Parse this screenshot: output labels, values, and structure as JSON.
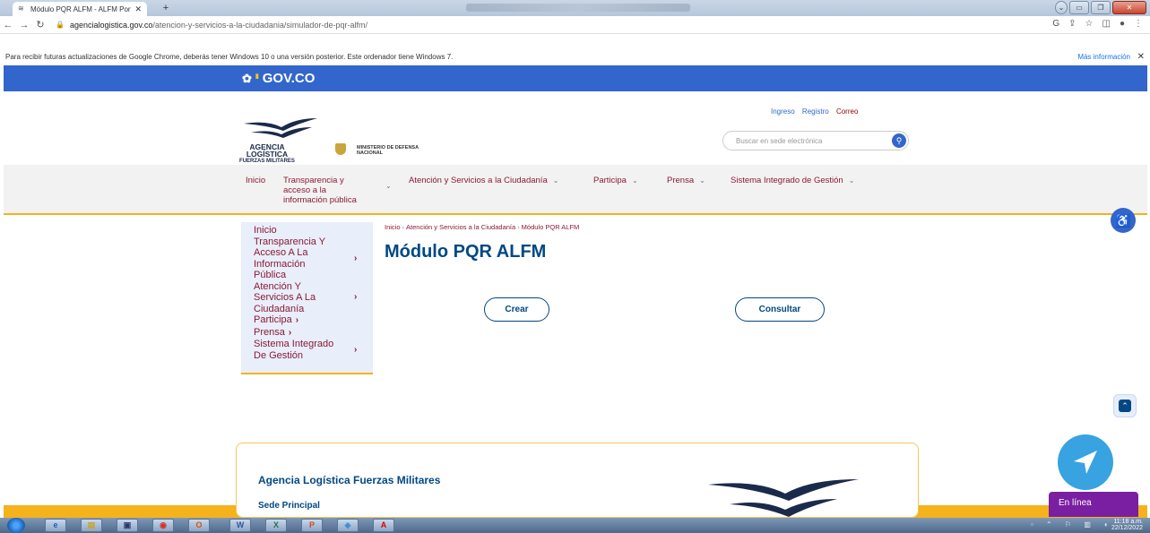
{
  "browser": {
    "tab_title": "Módulo PQR ALFM - ALFM Portal",
    "new_tab": "+",
    "url_domain": "agencialogistica.gov.co",
    "url_path": "/atencion-y-servicios-a-la-ciudadania/simulador-de-pqr-alfm/",
    "infobar_text": "Para recibir futuras actualizaciones de Google Chrome, deberás tener Windows 10 o una versión posterior. Este ordenador tiene Windows 7.",
    "infobar_link": "Más información"
  },
  "gov": {
    "brand": "GOV.CO"
  },
  "header": {
    "agency_line1": "AGENCIA LOGÍSTICA",
    "agency_line2": "FUERZAS MILITARES",
    "ministry_line1": "MINISTERIO DE DEFENSA",
    "ministry_line2": "NACIONAL",
    "links": {
      "ingreso": "Ingreso",
      "registro": "Registro",
      "correo": "Correo"
    },
    "search_placeholder": "Buscar en sede electrónica"
  },
  "nav": {
    "inicio": "Inicio",
    "transparencia": [
      "Transparencia y",
      "acceso a la",
      "información pública"
    ],
    "atencion": "Atención y Servicios a la Ciudadanía",
    "participa": "Participa",
    "prensa": "Prensa",
    "sig": "Sistema Integrado de Gestión"
  },
  "sidebar": {
    "inicio": "Inicio",
    "transparencia": [
      "Transparencia Y",
      "Acceso A La",
      "Información",
      "Pública"
    ],
    "atencion": [
      "Atención Y",
      "Servicios A La",
      "Ciudadanía"
    ],
    "participa": "Participa",
    "prensa": "Prensa",
    "sig": [
      "Sistema Integrado",
      "De Gestión"
    ]
  },
  "breadcrumb": {
    "home": "Inicio",
    "section": "Atención y Servicios a la Ciudadanía",
    "current": "Módulo PQR ALFM"
  },
  "page": {
    "title": "Módulo PQR ALFM",
    "create_label": "Crear",
    "consult_label": "Consultar"
  },
  "footer": {
    "agency": "Agencia Logística Fuerzas Militares",
    "sede": "Sede Principal"
  },
  "chat": {
    "online_label": "En línea"
  },
  "taskbar": {
    "time": "11:18 a.m.",
    "date": "22/12/2022"
  },
  "colors": {
    "gov_blue": "#3366cc",
    "title_blue": "#004884",
    "link_maroon": "#8b1a35",
    "accent_yellow": "#f5b21b",
    "chat_purple": "#7a1fa2"
  }
}
